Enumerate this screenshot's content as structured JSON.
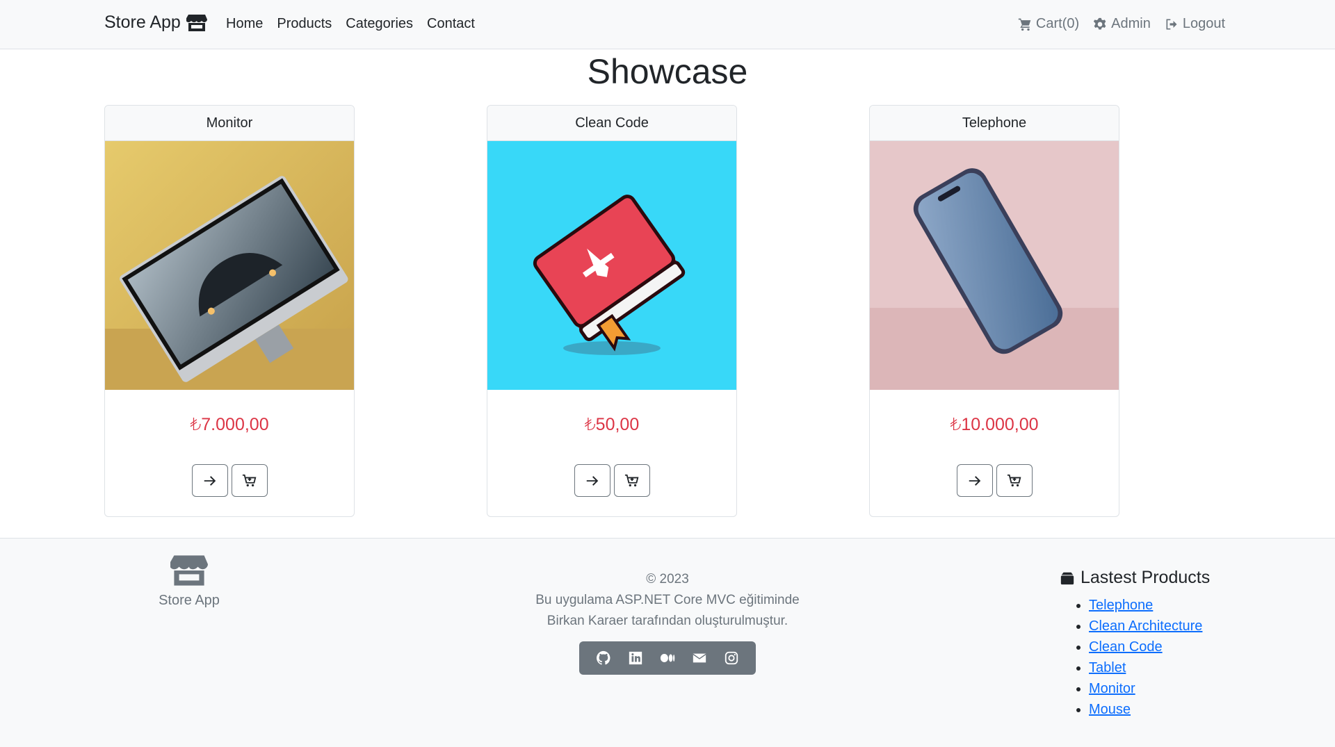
{
  "navbar": {
    "brand": "Store App",
    "links": [
      "Home",
      "Products",
      "Categories",
      "Contact"
    ],
    "cart_label": "Cart(0)",
    "admin_label": "Admin",
    "logout_label": "Logout"
  },
  "page_title": "Showcase",
  "products": [
    {
      "name": "Monitor",
      "price": "₺7.000,00"
    },
    {
      "name": "Clean Code",
      "price": "₺50,00"
    },
    {
      "name": "Telephone",
      "price": "₺10.000,00"
    }
  ],
  "footer": {
    "brand": "Store App",
    "copyright": "© 2023",
    "line1": "Bu uygulama ASP.NET Core MVC eğitiminde",
    "line2": "Birkan Karaer tarafından oluşturulmuştur.",
    "social_icons": [
      "github-icon",
      "linkedin-icon",
      "medium-icon",
      "envelope-icon",
      "instagram-icon"
    ],
    "latest_title": "Lastest Products",
    "latest": [
      "Telephone",
      "Clean Architecture",
      "Clean Code",
      "Tablet",
      "Monitor",
      "Mouse"
    ]
  },
  "colors": {
    "price": "#dc3545",
    "link": "#0d6efd",
    "muted": "#6c757d",
    "navbar_bg": "#f8f9fa"
  }
}
